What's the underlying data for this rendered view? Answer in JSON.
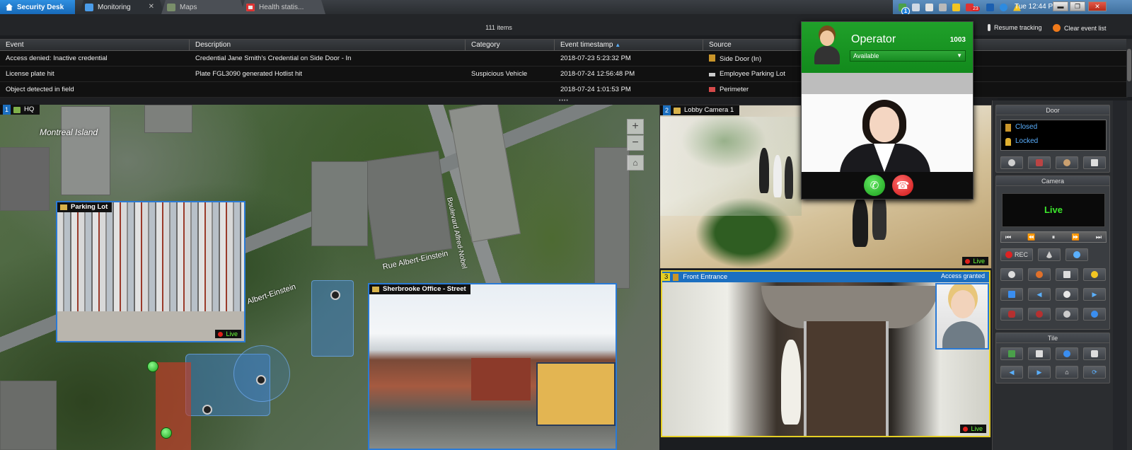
{
  "app": {
    "home_tab": "Security Desk",
    "tabs": [
      {
        "label": "Monitoring",
        "icon": "monitoring-icon",
        "active": true
      },
      {
        "label": "Maps",
        "icon": "maps-icon",
        "active": false
      },
      {
        "label": "Health statis...",
        "icon": "health-icon",
        "active": false
      }
    ],
    "tray": {
      "time": "Tue 12:44 PM",
      "alarm_count": "23",
      "info_badge": "1"
    }
  },
  "events": {
    "count_label": "111 items",
    "resume_tracking": "Resume tracking",
    "clear_event_list": "Clear event list",
    "columns": [
      "Event",
      "Description",
      "Category",
      "Event timestamp",
      "Source"
    ],
    "rows": [
      {
        "event": "Access denied: Inactive credential",
        "description": "Credential Jane Smith's Credential on Side Door - In",
        "category": "",
        "timestamp": "2018-07-23 5:23:32 PM",
        "source": "Side Door (In)"
      },
      {
        "event": "License plate hit",
        "description": "Plate FGL3090 generated Hotlist hit",
        "category": "Suspicious Vehicle",
        "timestamp": "2018-07-24 12:56:48 PM",
        "source": "Employee Parking Lot"
      },
      {
        "event": "Object detected in field",
        "description": "",
        "category": "",
        "timestamp": "2018-07-24 1:01:53 PM",
        "source": "Perimeter"
      }
    ]
  },
  "tiles": {
    "map": {
      "num": "1",
      "title": "HQ",
      "place_label": "Montreal Island",
      "road1": "Rue Albert-Einstein",
      "road2": "Albert-Einstein",
      "road3": "Boulevard Alfred-Nobel"
    },
    "lobby": {
      "num": "2",
      "title": "Lobby Camera 1",
      "live": "Live"
    },
    "front": {
      "num": "3",
      "title": "Front Entrance",
      "status": "Access granted",
      "live": "Live"
    },
    "parking_overlay": {
      "title": "Parking Lot",
      "live": "Live"
    },
    "street_overlay": {
      "title": "Sherbrooke Office - Street"
    }
  },
  "operator": {
    "title": "Operator",
    "extension": "1003",
    "status": "Available"
  },
  "panel": {
    "door_title": "Door",
    "door_state1": "Closed",
    "door_state2": "Locked",
    "camera_title": "Camera",
    "camera_live": "Live",
    "rec_label": "REC",
    "tile_title": "Tile"
  },
  "colors": {
    "accent": "#1c6fc0",
    "live_green": "#3ce82c",
    "operator_green": "#169423",
    "selection_yellow": "#e5cf25"
  }
}
